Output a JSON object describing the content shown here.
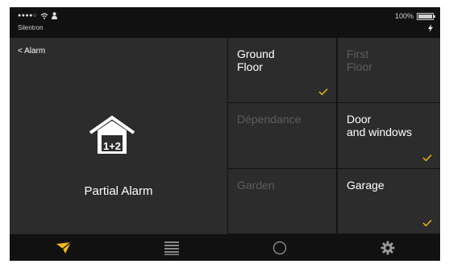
{
  "status_bar": {
    "carrier": "Silentron",
    "battery_text": "100%",
    "icons": [
      "signal-dots-icon",
      "wifi-icon",
      "user-icon",
      "battery-icon",
      "charging-bolt-icon"
    ]
  },
  "left_panel": {
    "back_label": "< Alarm",
    "house_badge": "1+2",
    "mode_label": "Partial Alarm",
    "icon": "house-icon"
  },
  "zones": [
    {
      "label": "Ground\nFloor",
      "active": true,
      "checked": true
    },
    {
      "label": "First\nFloor",
      "active": false,
      "checked": false
    },
    {
      "label": "Dépendance",
      "active": false,
      "checked": false
    },
    {
      "label": "Door\nand windows",
      "active": true,
      "checked": true
    },
    {
      "label": "Garden",
      "active": false,
      "checked": false
    },
    {
      "label": "Garage",
      "active": true,
      "checked": true
    }
  ],
  "nav": {
    "items": [
      "paper-plane-icon",
      "list-icon",
      "circle-icon",
      "gear-icon"
    ],
    "selected_index": 0
  },
  "colors": {
    "accent": "#f3b81a",
    "background": "#111111",
    "panel": "#2c2c2c",
    "text_active": "#ffffff",
    "text_inactive": "#5c5c5c"
  }
}
